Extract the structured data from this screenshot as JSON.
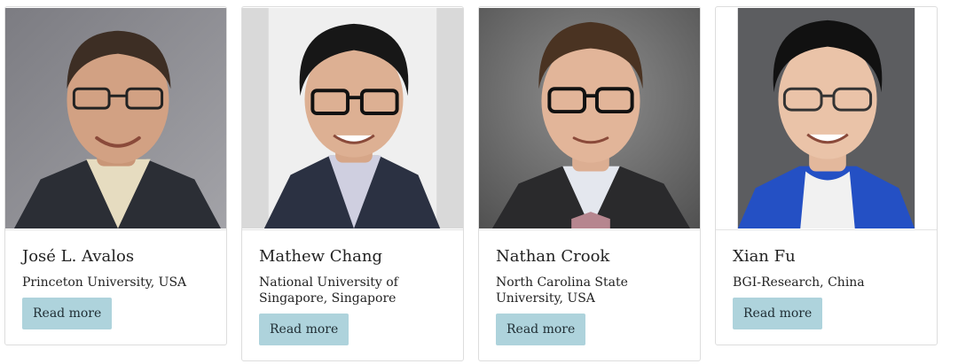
{
  "people": [
    {
      "name": "José L. Avalos",
      "affiliation": "Princeton University, USA",
      "button_label": "Read more",
      "photo_background": "#8d8d91"
    },
    {
      "name": "Mathew Chang",
      "affiliation": "National University of Singapore, Singapore",
      "button_label": "Read more",
      "photo_background": "#e9e9e9"
    },
    {
      "name": "Nathan Crook",
      "affiliation": "North Carolina State University, USA",
      "button_label": "Read more",
      "photo_background": "#6f6f6f"
    },
    {
      "name": "Xian Fu",
      "affiliation": "BGI-Research, China",
      "button_label": "Read more",
      "photo_background": "#5c5d60"
    }
  ],
  "colors": {
    "button_background": "#aed3dc",
    "card_border": "#dddddd"
  }
}
